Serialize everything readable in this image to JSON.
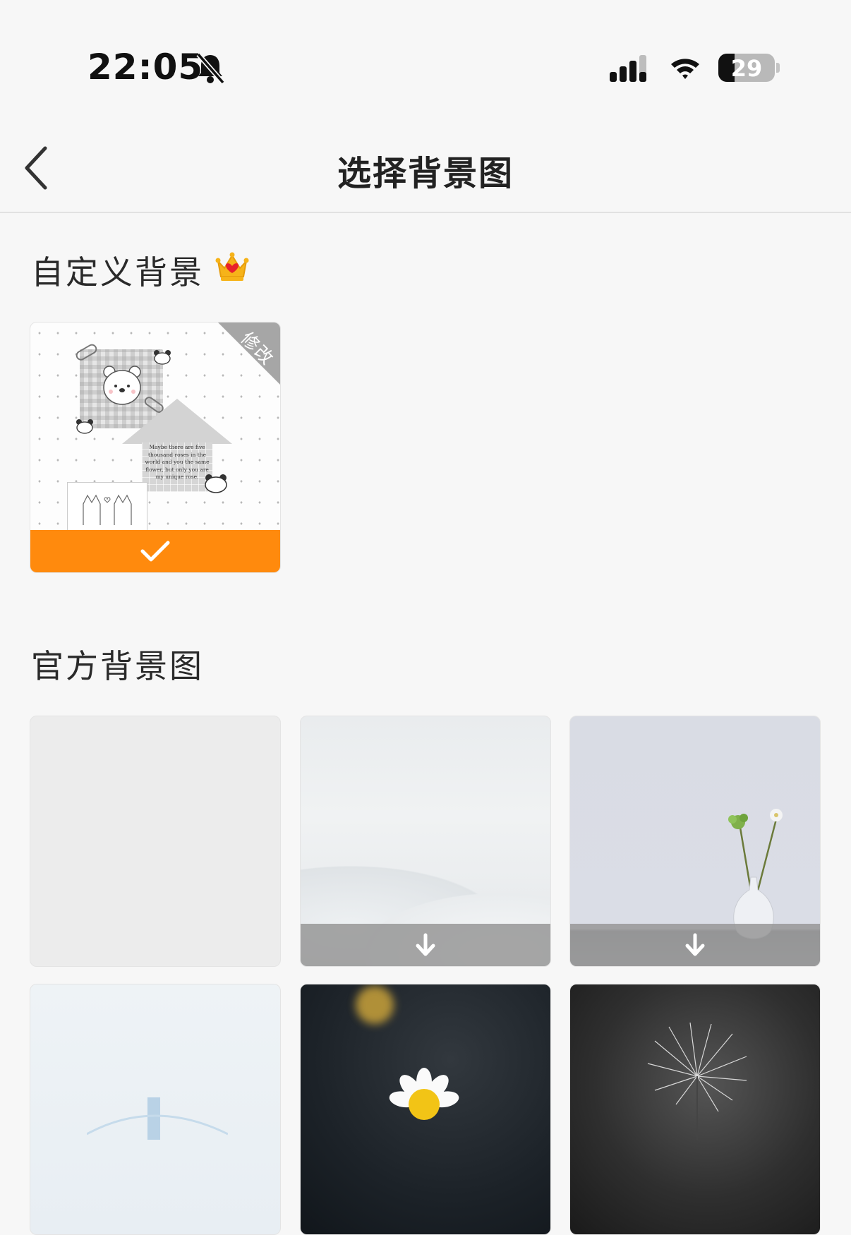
{
  "status_bar": {
    "time": "22:05",
    "battery_level": "29",
    "battery_fraction": 0.29,
    "icons": [
      "bell-muted-icon",
      "cellular-signal-icon",
      "wifi-icon",
      "battery-icon"
    ]
  },
  "nav": {
    "title": "选择背景图",
    "back_icon": "chevron-left-icon"
  },
  "custom_section": {
    "title": "自定义背景",
    "badge_icon": "crown-icon",
    "item": {
      "corner_label": "修改",
      "text": "Maybe there are five thousand roses in the world and you the same flower, but only you are my unique rose.",
      "selected": true,
      "selected_icon": "checkmark-icon"
    }
  },
  "official_section": {
    "title": "官方背景图",
    "items": [
      {
        "name": "plain-light-gray",
        "download_icon": null
      },
      {
        "name": "white-dunes",
        "download_icon": "download-arrow-icon"
      },
      {
        "name": "vase-with-flowers",
        "download_icon": "download-arrow-icon"
      },
      {
        "name": "misty-bridge",
        "download_icon": null
      },
      {
        "name": "daisy-dark",
        "download_icon": null
      },
      {
        "name": "dandelion-dark",
        "download_icon": null
      }
    ]
  },
  "colors": {
    "accent": "#ff8a0d",
    "background": "#f7f7f7",
    "download_bar": "#969696"
  }
}
